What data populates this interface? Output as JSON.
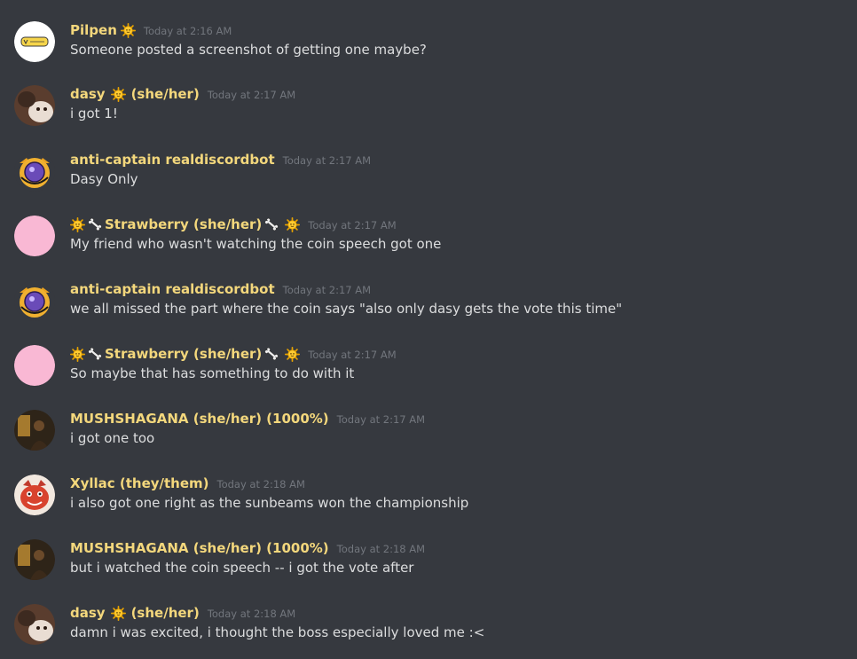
{
  "messages": [
    {
      "author": "Pilpen",
      "time": "Today at 2:16 AM",
      "text": "Someone posted a screenshot of getting one maybe?",
      "avatar": "yellow-sticker-avatar"
    },
    {
      "author": "dasy",
      "pronouns": "(she/her)",
      "time": "Today at 2:17 AM",
      "text": "i got 1!",
      "avatar": "cat-photo-avatar"
    },
    {
      "author": "anti-captain realdiscordbot",
      "time": "Today at 2:17 AM",
      "text": "Dasy Only",
      "avatar": "cartoon-cat-avatar"
    },
    {
      "author": "Strawberry (she/her)",
      "time": "Today at 2:17 AM",
      "text": "My friend who wasn't watching the coin speech got one",
      "avatar": "pink-circle-avatar"
    },
    {
      "author": "anti-captain realdiscordbot",
      "time": "Today at 2:17 AM",
      "text": "we all missed the part where the coin says \"also only dasy gets the vote this time\"",
      "avatar": "cartoon-cat-avatar"
    },
    {
      "author": "Strawberry (she/her)",
      "time": "Today at 2:17 AM",
      "text": "So maybe that has something to do with it",
      "avatar": "pink-circle-avatar"
    },
    {
      "author": "MUSHSHAGANA (she/her) (1000%)",
      "time": "Today at 2:17 AM",
      "text": "i got one too",
      "avatar": "dark-photo-avatar"
    },
    {
      "author": "Xyllac (they/them)",
      "time": "Today at 2:18 AM",
      "text": "i also got one right as the sunbeams won the championship",
      "avatar": "red-character-avatar"
    },
    {
      "author": "MUSHSHAGANA (she/her) (1000%)",
      "time": "Today at 2:18 AM",
      "text": "but i watched the coin speech -- i got the vote after",
      "avatar": "dark-photo-avatar"
    },
    {
      "author": "dasy",
      "pronouns": "(she/her)",
      "time": "Today at 2:18 AM",
      "text": "damn i was excited, i thought the boss especially loved me :<",
      "avatar": "cat-photo-avatar"
    }
  ],
  "icons": {
    "sun": "sun-emoji-icon",
    "bone": "bone-emoji-icon"
  },
  "colors": {
    "background": "#36393f",
    "author": "#f3d77c",
    "timestamp": "#72767d",
    "text": "#dcddde",
    "pink_avatar": "#f9b8d4"
  }
}
